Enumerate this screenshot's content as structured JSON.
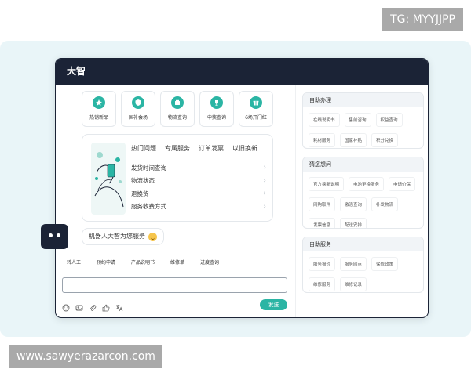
{
  "watermarks": {
    "top": "TG: MYYJJPP",
    "bottom": "www.sawyerazarcon.com"
  },
  "colors": {
    "accent": "#2bb5a4",
    "titlebar": "#1b2336",
    "canvas": "#e9f5f8"
  },
  "window": {
    "title": "大智"
  },
  "quick_services": [
    {
      "label": "热销新品",
      "icon": "star-badge-icon"
    },
    {
      "label": "国补会场",
      "icon": "shield-icon"
    },
    {
      "label": "物流查询",
      "icon": "package-icon"
    },
    {
      "label": "中奖查询",
      "icon": "trophy-icon"
    },
    {
      "label": "6场开门红",
      "icon": "gift-icon"
    }
  ],
  "faq": {
    "tabs": [
      "热门问题",
      "专属服务",
      "订单发票",
      "以旧换新"
    ],
    "items": [
      "发货时间查询",
      "物流状态",
      "退换货",
      "服务收费方式"
    ]
  },
  "chat": {
    "greeting": "机器人大智为您服务",
    "actions": [
      "转人工",
      "预约申请",
      "产品说明书",
      "维修单",
      "进度查询"
    ],
    "input_placeholder": "",
    "send_label": "发送",
    "toolbar_icons": [
      "emoji-icon",
      "image-icon",
      "attachment-icon",
      "thumbs-up-icon",
      "translate-icon"
    ]
  },
  "sidebar": {
    "self_service": {
      "title": "自助办理",
      "items": [
        "在线说明书",
        "售前咨询",
        "权益查询",
        "耗材服务",
        "国家补贴",
        "积分兑换"
      ]
    },
    "guess": {
      "title": "猜您想问",
      "items": [
        "官方换新说明",
        "电池更换服务",
        "申请价保",
        "网购取件",
        "激活查询",
        "补发物流",
        "发票信息",
        "配送安排"
      ]
    },
    "services": {
      "title": "自助服务",
      "items": [
        "服务报价",
        "服务网点",
        "保修政策",
        "维修服务",
        "维修记录"
      ]
    }
  }
}
